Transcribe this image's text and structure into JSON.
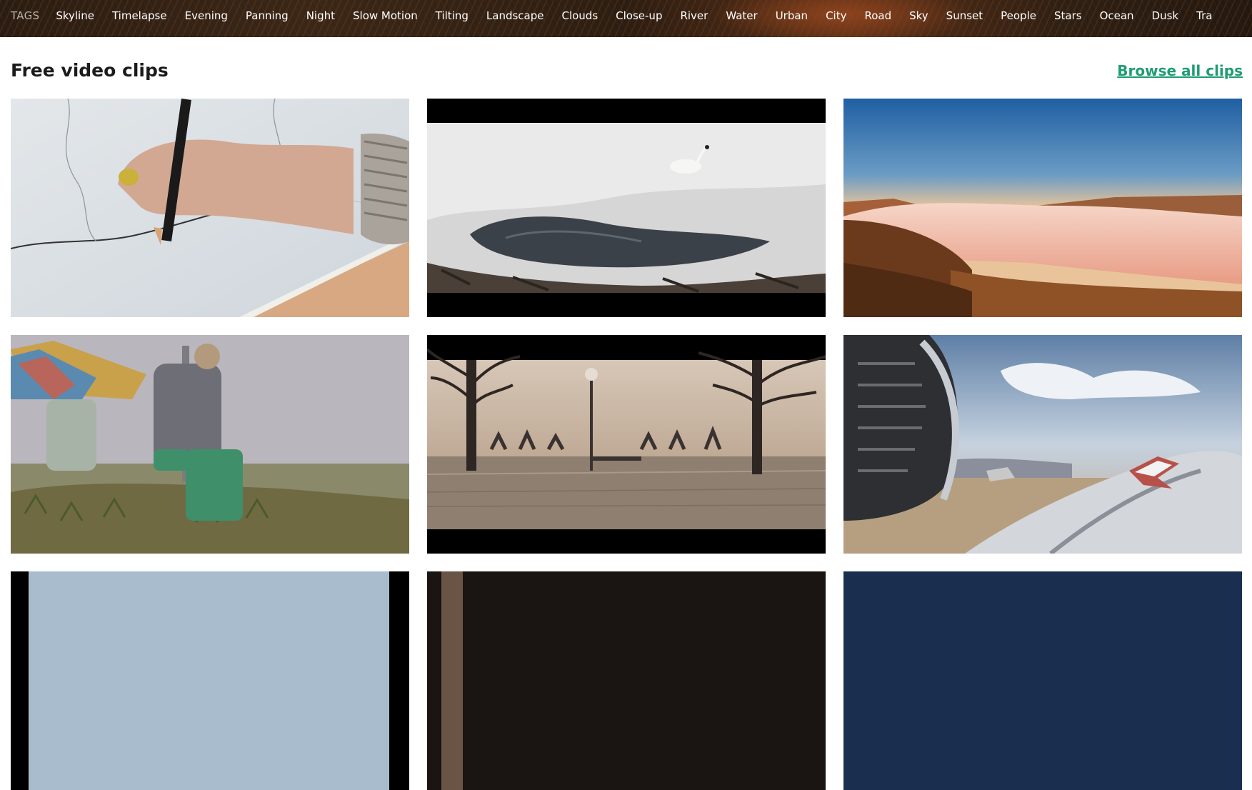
{
  "tags": {
    "label": "TAGS",
    "items": [
      "Skyline",
      "Timelapse",
      "Evening",
      "Panning",
      "Night",
      "Slow Motion",
      "Tilting",
      "Landscape",
      "Clouds",
      "Close-up",
      "River",
      "Water",
      "Urban",
      "City",
      "Road",
      "Sky",
      "Sunset",
      "People",
      "Stars",
      "Ocean",
      "Dusk",
      "Tra"
    ]
  },
  "section": {
    "title": "Free video clips",
    "browse_link": "Browse all clips"
  },
  "clips": [
    {
      "subject": "hand drawing on a map with a pencil"
    },
    {
      "subject": "swan on snow beside a stream"
    },
    {
      "subject": "sea of clouds over cliffs"
    },
    {
      "subject": "workers unloading pineapples"
    },
    {
      "subject": "flooded park with bare trees"
    },
    {
      "subject": "wrecked aircraft in a desert"
    },
    {
      "subject": "partial clip"
    },
    {
      "subject": "partial clip"
    },
    {
      "subject": "partial clip"
    }
  ],
  "colors": {
    "link": "#1f9d72",
    "title": "#1b1b1b",
    "tags_label": "#b8b2ad"
  }
}
